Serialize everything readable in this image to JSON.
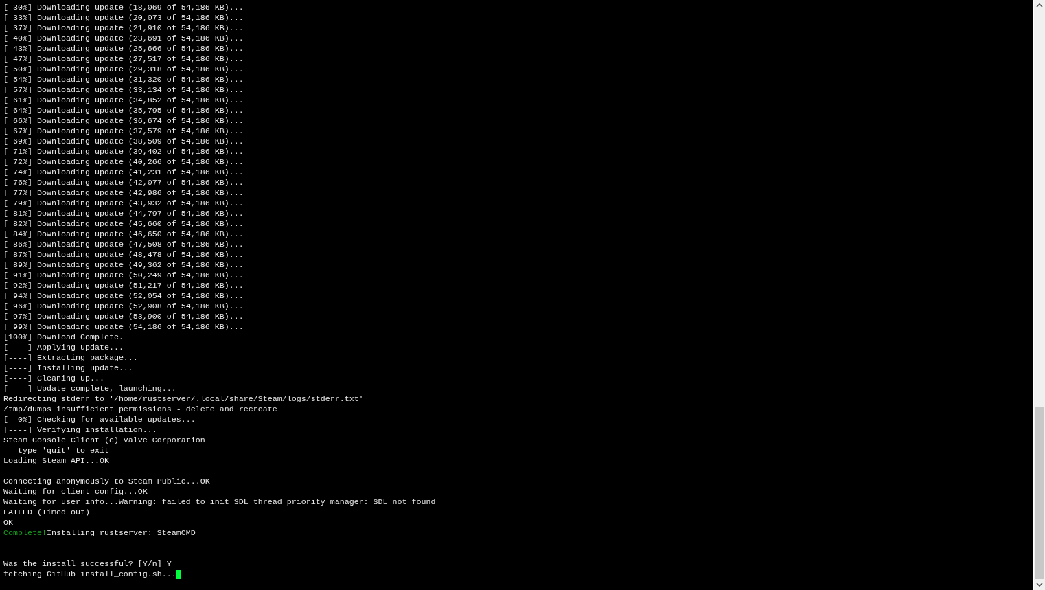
{
  "terminal": {
    "lines": [
      {
        "kind": "plain",
        "text": "[ 30%] Downloading update (18,069 of 54,186 KB)..."
      },
      {
        "kind": "plain",
        "text": "[ 33%] Downloading update (20,073 of 54,186 KB)..."
      },
      {
        "kind": "plain",
        "text": "[ 37%] Downloading update (21,910 of 54,186 KB)..."
      },
      {
        "kind": "plain",
        "text": "[ 40%] Downloading update (23,691 of 54,186 KB)..."
      },
      {
        "kind": "plain",
        "text": "[ 43%] Downloading update (25,666 of 54,186 KB)..."
      },
      {
        "kind": "plain",
        "text": "[ 47%] Downloading update (27,517 of 54,186 KB)..."
      },
      {
        "kind": "plain",
        "text": "[ 50%] Downloading update (29,318 of 54,186 KB)..."
      },
      {
        "kind": "plain",
        "text": "[ 54%] Downloading update (31,320 of 54,186 KB)..."
      },
      {
        "kind": "plain",
        "text": "[ 57%] Downloading update (33,134 of 54,186 KB)..."
      },
      {
        "kind": "plain",
        "text": "[ 61%] Downloading update (34,852 of 54,186 KB)..."
      },
      {
        "kind": "plain",
        "text": "[ 64%] Downloading update (35,795 of 54,186 KB)..."
      },
      {
        "kind": "plain",
        "text": "[ 66%] Downloading update (36,674 of 54,186 KB)..."
      },
      {
        "kind": "plain",
        "text": "[ 67%] Downloading update (37,579 of 54,186 KB)..."
      },
      {
        "kind": "plain",
        "text": "[ 69%] Downloading update (38,509 of 54,186 KB)..."
      },
      {
        "kind": "plain",
        "text": "[ 71%] Downloading update (39,402 of 54,186 KB)..."
      },
      {
        "kind": "plain",
        "text": "[ 72%] Downloading update (40,266 of 54,186 KB)..."
      },
      {
        "kind": "plain",
        "text": "[ 74%] Downloading update (41,231 of 54,186 KB)..."
      },
      {
        "kind": "plain",
        "text": "[ 76%] Downloading update (42,077 of 54,186 KB)..."
      },
      {
        "kind": "plain",
        "text": "[ 77%] Downloading update (42,986 of 54,186 KB)..."
      },
      {
        "kind": "plain",
        "text": "[ 79%] Downloading update (43,932 of 54,186 KB)..."
      },
      {
        "kind": "plain",
        "text": "[ 81%] Downloading update (44,797 of 54,186 KB)..."
      },
      {
        "kind": "plain",
        "text": "[ 82%] Downloading update (45,660 of 54,186 KB)..."
      },
      {
        "kind": "plain",
        "text": "[ 84%] Downloading update (46,650 of 54,186 KB)..."
      },
      {
        "kind": "plain",
        "text": "[ 86%] Downloading update (47,508 of 54,186 KB)..."
      },
      {
        "kind": "plain",
        "text": "[ 87%] Downloading update (48,478 of 54,186 KB)..."
      },
      {
        "kind": "plain",
        "text": "[ 89%] Downloading update (49,362 of 54,186 KB)..."
      },
      {
        "kind": "plain",
        "text": "[ 91%] Downloading update (50,249 of 54,186 KB)..."
      },
      {
        "kind": "plain",
        "text": "[ 92%] Downloading update (51,217 of 54,186 KB)..."
      },
      {
        "kind": "plain",
        "text": "[ 94%] Downloading update (52,054 of 54,186 KB)..."
      },
      {
        "kind": "plain",
        "text": "[ 96%] Downloading update (52,908 of 54,186 KB)..."
      },
      {
        "kind": "plain",
        "text": "[ 97%] Downloading update (53,900 of 54,186 KB)..."
      },
      {
        "kind": "plain",
        "text": "[ 99%] Downloading update (54,186 of 54,186 KB)..."
      },
      {
        "kind": "plain",
        "text": "[100%] Download Complete."
      },
      {
        "kind": "plain",
        "text": "[----] Applying update..."
      },
      {
        "kind": "plain",
        "text": "[----] Extracting package..."
      },
      {
        "kind": "plain",
        "text": "[----] Installing update..."
      },
      {
        "kind": "plain",
        "text": "[----] Cleaning up..."
      },
      {
        "kind": "plain",
        "text": "[----] Update complete, launching..."
      },
      {
        "kind": "plain",
        "text": "Redirecting stderr to '/home/rustserver/.local/share/Steam/logs/stderr.txt'"
      },
      {
        "kind": "plain",
        "text": "/tmp/dumps insufficient permissions - delete and recreate"
      },
      {
        "kind": "plain",
        "text": "[  0%] Checking for available updates..."
      },
      {
        "kind": "plain",
        "text": "[----] Verifying installation..."
      },
      {
        "kind": "plain",
        "text": "Steam Console Client (c) Valve Corporation"
      },
      {
        "kind": "plain",
        "text": "-- type 'quit' to exit --"
      },
      {
        "kind": "plain",
        "text": "Loading Steam API...OK"
      },
      {
        "kind": "blank"
      },
      {
        "kind": "plain",
        "text": "Connecting anonymously to Steam Public...OK"
      },
      {
        "kind": "plain",
        "text": "Waiting for client config...OK"
      },
      {
        "kind": "plain",
        "text": "Waiting for user info...Warning: failed to init SDL thread priority manager: SDL not found"
      },
      {
        "kind": "plain",
        "text": "FAILED (Timed out)"
      },
      {
        "kind": "plain",
        "text": "OK"
      },
      {
        "kind": "status",
        "status": "Complete!",
        "text": "Installing rustserver: SteamCMD"
      },
      {
        "kind": "blank"
      },
      {
        "kind": "plain",
        "text": "================================="
      },
      {
        "kind": "plain",
        "text": "Was the install successful? [Y/n] Y"
      },
      {
        "kind": "prompt",
        "text": "fetching GitHub install_config.sh...",
        "cursor": true
      }
    ]
  }
}
